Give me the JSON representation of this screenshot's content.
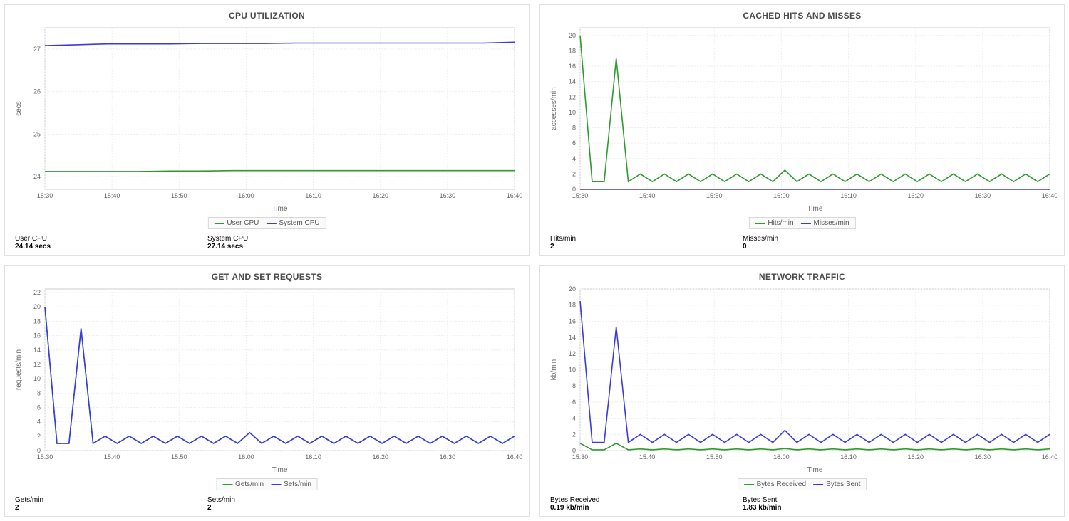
{
  "colors": {
    "green": "#2e9b2e",
    "blue": "#3a3ae0"
  },
  "panels": [
    {
      "id": "cpu",
      "title": "CPU UTILIZATION",
      "legend": [
        "User CPU",
        "System CPU"
      ],
      "stats": [
        {
          "label": "User CPU",
          "value": "24.14 secs"
        },
        {
          "label": "System CPU",
          "value": "27.14 secs"
        }
      ]
    },
    {
      "id": "cache",
      "title": "CACHED HITS AND MISSES",
      "legend": [
        "Hits/min",
        "Misses/min"
      ],
      "stats": [
        {
          "label": "Hits/min",
          "value": "2"
        },
        {
          "label": "Misses/min",
          "value": "0"
        }
      ]
    },
    {
      "id": "reqs",
      "title": "GET AND SET REQUESTS",
      "legend": [
        "Gets/min",
        "Sets/min"
      ],
      "stats": [
        {
          "label": "Gets/min",
          "value": "2"
        },
        {
          "label": "Sets/min",
          "value": "2"
        }
      ]
    },
    {
      "id": "net",
      "title": "NETWORK TRAFFIC",
      "legend": [
        "Bytes Received",
        "Bytes Sent"
      ],
      "stats": [
        {
          "label": "Bytes Received",
          "value": "0.19 kb/min"
        },
        {
          "label": "Bytes Sent",
          "value": "1.83 kb/min"
        }
      ]
    }
  ],
  "chart_data": [
    {
      "id": "cpu",
      "type": "line",
      "title": "CPU UTILIZATION",
      "xlabel": "Time",
      "ylabel": "secs",
      "ylim": [
        23.7,
        27.5
      ],
      "yticks": [
        24,
        25,
        26,
        27
      ],
      "x_categories": [
        "15:30",
        "15:40",
        "15:50",
        "16:00",
        "16:10",
        "16:20",
        "16:30",
        "16:40"
      ],
      "x_values": [
        0,
        1,
        2,
        3,
        4,
        5,
        6,
        7,
        8,
        9,
        10,
        11,
        12,
        13,
        14,
        15
      ],
      "series": [
        {
          "name": "User CPU",
          "color_key": "green",
          "values": [
            24.12,
            24.12,
            24.12,
            24.12,
            24.13,
            24.13,
            24.14,
            24.14,
            24.14,
            24.14,
            24.14,
            24.14,
            24.14,
            24.14,
            24.14,
            24.14
          ]
        },
        {
          "name": "System CPU",
          "color_key": "blue",
          "values": [
            27.08,
            27.1,
            27.12,
            27.12,
            27.12,
            27.13,
            27.13,
            27.13,
            27.14,
            27.14,
            27.14,
            27.14,
            27.14,
            27.14,
            27.14,
            27.16
          ]
        }
      ]
    },
    {
      "id": "cache",
      "type": "line",
      "title": "CACHED HITS AND MISSES",
      "xlabel": "Time",
      "ylabel": "accesses/min",
      "ylim": [
        0,
        21
      ],
      "yticks": [
        0,
        2,
        4,
        6,
        8,
        10,
        12,
        14,
        16,
        18,
        20
      ],
      "x_categories": [
        "15:30",
        "15:40",
        "15:50",
        "16:00",
        "16:10",
        "16:20",
        "16:30",
        "16:40"
      ],
      "x_values": [
        0,
        1,
        2,
        3,
        4,
        5,
        6,
        7,
        8,
        9,
        10,
        11,
        12,
        13,
        14,
        15,
        16,
        17,
        18,
        19,
        20,
        21,
        22,
        23,
        24,
        25,
        26,
        27,
        28,
        29,
        30,
        31,
        32,
        33,
        34,
        35,
        36,
        37,
        38,
        39
      ],
      "series": [
        {
          "name": "Hits/min",
          "color_key": "green",
          "values": [
            20,
            1,
            1,
            17,
            1,
            2,
            1,
            2,
            1,
            2,
            1,
            2,
            1,
            2,
            1,
            2,
            1,
            2.5,
            1,
            2,
            1,
            2,
            1,
            2,
            1,
            2,
            1,
            2,
            1,
            2,
            1,
            2,
            1,
            2,
            1,
            2,
            1,
            2,
            1,
            2
          ]
        },
        {
          "name": "Misses/min",
          "color_key": "blue",
          "values": [
            0,
            0,
            0,
            0,
            0,
            0,
            0,
            0,
            0,
            0,
            0,
            0,
            0,
            0,
            0,
            0,
            0,
            0,
            0,
            0,
            0,
            0,
            0,
            0,
            0,
            0,
            0,
            0,
            0,
            0,
            0,
            0,
            0,
            0,
            0,
            0,
            0,
            0,
            0,
            0
          ]
        }
      ]
    },
    {
      "id": "reqs",
      "type": "line",
      "title": "GET AND SET REQUESTS",
      "xlabel": "Time",
      "ylabel": "requests/min",
      "ylim": [
        0,
        22.5
      ],
      "yticks": [
        0,
        2,
        4,
        6,
        8,
        10,
        12,
        14,
        16,
        18,
        20,
        22
      ],
      "x_categories": [
        "15:30",
        "15:40",
        "15:50",
        "16:00",
        "16:10",
        "16:20",
        "16:30",
        "16:40"
      ],
      "x_values": [
        0,
        1,
        2,
        3,
        4,
        5,
        6,
        7,
        8,
        9,
        10,
        11,
        12,
        13,
        14,
        15,
        16,
        17,
        18,
        19,
        20,
        21,
        22,
        23,
        24,
        25,
        26,
        27,
        28,
        29,
        30,
        31,
        32,
        33,
        34,
        35,
        36,
        37,
        38,
        39
      ],
      "series": [
        {
          "name": "Gets/min",
          "color_key": "green",
          "values": [
            20,
            1,
            1,
            17,
            1,
            2,
            1,
            2,
            1,
            2,
            1,
            2,
            1,
            2,
            1,
            2,
            1,
            2.5,
            1,
            2,
            1,
            2,
            1,
            2,
            1,
            2,
            1,
            2,
            1,
            2,
            1,
            2,
            1,
            2,
            1,
            2,
            1,
            2,
            1,
            2
          ]
        },
        {
          "name": "Sets/min",
          "color_key": "blue",
          "values": [
            20,
            1,
            1,
            17,
            1,
            2,
            1,
            2,
            1,
            2,
            1,
            2,
            1,
            2,
            1,
            2,
            1,
            2.5,
            1,
            2,
            1,
            2,
            1,
            2,
            1,
            2,
            1,
            2,
            1,
            2,
            1,
            2,
            1,
            2,
            1,
            2,
            1,
            2,
            1,
            2
          ]
        }
      ]
    },
    {
      "id": "net",
      "type": "line",
      "title": "NETWORK TRAFFIC",
      "xlabel": "Time",
      "ylabel": "kb/min",
      "ylim": [
        0,
        20
      ],
      "yticks": [
        0,
        2,
        4,
        6,
        8,
        10,
        12,
        14,
        16,
        18,
        20
      ],
      "x_categories": [
        "15:30",
        "15:40",
        "15:50",
        "16:00",
        "16:10",
        "16:20",
        "16:30",
        "16:40"
      ],
      "x_values": [
        0,
        1,
        2,
        3,
        4,
        5,
        6,
        7,
        8,
        9,
        10,
        11,
        12,
        13,
        14,
        15,
        16,
        17,
        18,
        19,
        20,
        21,
        22,
        23,
        24,
        25,
        26,
        27,
        28,
        29,
        30,
        31,
        32,
        33,
        34,
        35,
        36,
        37,
        38,
        39
      ],
      "series": [
        {
          "name": "Bytes Received",
          "color_key": "green",
          "values": [
            0.9,
            0.1,
            0.1,
            0.9,
            0.1,
            0.2,
            0.1,
            0.2,
            0.1,
            0.2,
            0.1,
            0.2,
            0.1,
            0.2,
            0.1,
            0.2,
            0.1,
            0.25,
            0.1,
            0.2,
            0.1,
            0.2,
            0.1,
            0.2,
            0.1,
            0.2,
            0.1,
            0.2,
            0.1,
            0.2,
            0.1,
            0.2,
            0.1,
            0.2,
            0.1,
            0.2,
            0.1,
            0.2,
            0.1,
            0.2
          ]
        },
        {
          "name": "Bytes Sent",
          "color_key": "blue",
          "values": [
            18.5,
            1,
            1,
            15.3,
            1,
            2,
            1,
            2,
            1,
            2,
            1,
            2,
            1,
            2,
            1,
            2,
            1,
            2.5,
            1,
            2,
            1,
            2,
            1,
            2,
            1,
            2,
            1,
            2,
            1,
            2,
            1,
            2,
            1,
            2,
            1,
            2,
            1,
            2,
            1,
            2
          ]
        }
      ]
    }
  ]
}
